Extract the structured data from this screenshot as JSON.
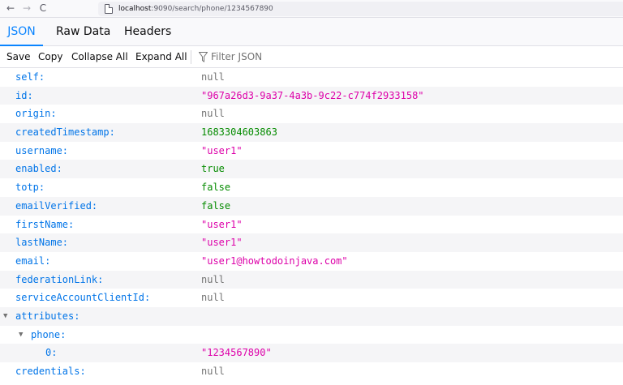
{
  "browser": {
    "nav_back": "←",
    "nav_forward": "→",
    "nav_reload": "C",
    "url_host": "localhost",
    "url_rest": ":9090/search/phone/1234567890"
  },
  "tabs": {
    "json": "JSON",
    "raw": "Raw Data",
    "headers": "Headers",
    "active": "JSON"
  },
  "toolbar": {
    "save": "Save",
    "copy": "Copy",
    "collapse_all": "Collapse All",
    "expand_all": "Expand All",
    "filter_placeholder": "Filter JSON"
  },
  "json_rows": [
    {
      "key": "self:",
      "value": "null",
      "type": "null"
    },
    {
      "key": "id:",
      "value": "\"967a26d3-9a37-4a3b-9c22-c774f2933158\"",
      "type": "string"
    },
    {
      "key": "origin:",
      "value": "null",
      "type": "null"
    },
    {
      "key": "createdTimestamp:",
      "value": "1683304603863",
      "type": "number"
    },
    {
      "key": "username:",
      "value": "\"user1\"",
      "type": "string"
    },
    {
      "key": "enabled:",
      "value": "true",
      "type": "boolean"
    },
    {
      "key": "totp:",
      "value": "false",
      "type": "boolean"
    },
    {
      "key": "emailVerified:",
      "value": "false",
      "type": "boolean"
    },
    {
      "key": "firstName:",
      "value": "\"user1\"",
      "type": "string"
    },
    {
      "key": "lastName:",
      "value": "\"user1\"",
      "type": "string"
    },
    {
      "key": "email:",
      "value": "\"user1@howtodoinjava.com\"",
      "type": "string"
    },
    {
      "key": "federationLink:",
      "value": "null",
      "type": "null"
    },
    {
      "key": "serviceAccountClientId:",
      "value": "null",
      "type": "null"
    },
    {
      "key": "attributes:",
      "value": "",
      "type": "object",
      "expanded": true
    },
    {
      "key": "phone:",
      "value": "",
      "type": "array",
      "expanded": true
    },
    {
      "key": "0:",
      "value": "\"1234567890\"",
      "type": "string"
    },
    {
      "key": "credentials:",
      "value": "null",
      "type": "null"
    }
  ],
  "colors": {
    "key": "#0074e8",
    "string": "#dd00a9",
    "number_bool": "#058b00",
    "null": "#737373",
    "active_tab": "#0a84ff"
  },
  "icons": {
    "filter": "filter-funnel-icon",
    "expand": "triangle-down-icon",
    "page": "page-icon"
  }
}
